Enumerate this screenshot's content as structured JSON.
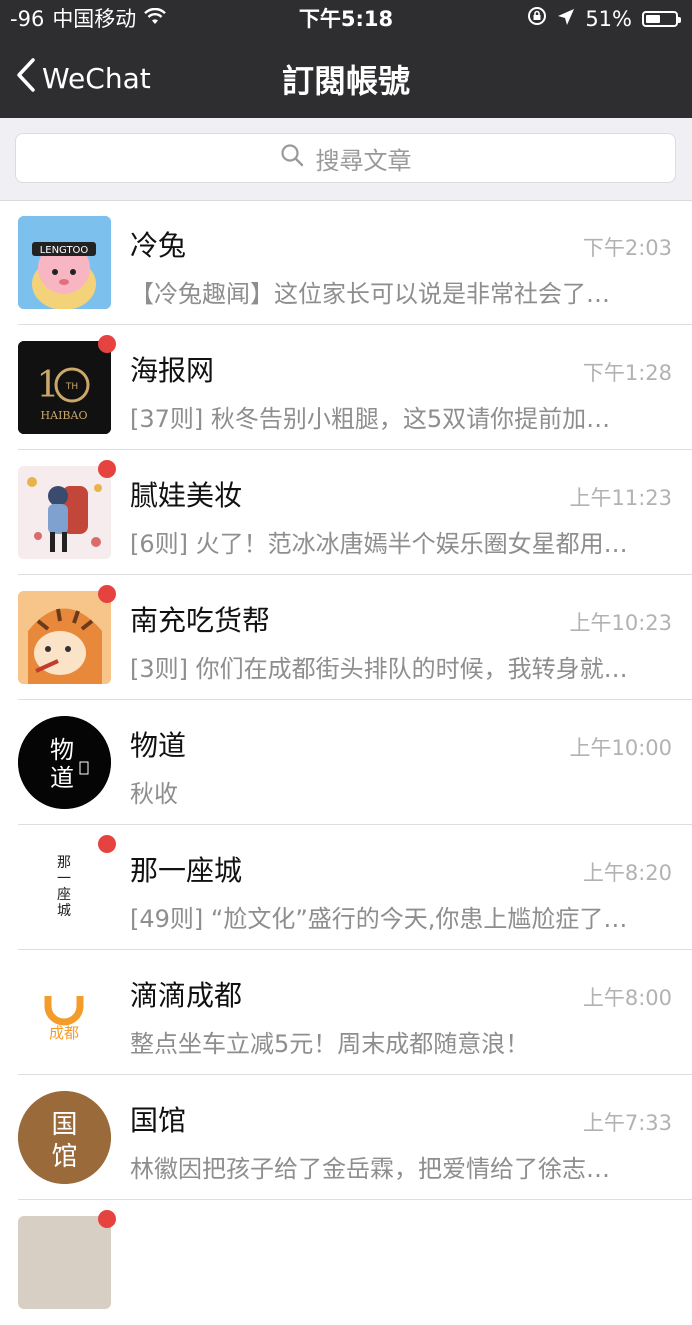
{
  "status_bar": {
    "signal": "-96",
    "carrier": "中国移动",
    "time": "下午5:18",
    "battery": "51%",
    "battery_level": 0.51
  },
  "nav": {
    "back_label": "WeChat",
    "title": "訂閱帳號"
  },
  "search": {
    "placeholder": "搜尋文章"
  },
  "items": [
    {
      "name": "冷兔",
      "time": "下午2:03",
      "preview": "【冷兔趣闻】这位家长可以说是非常社会了…",
      "unread": false,
      "avatar_text": "LENGTOO",
      "avatar_color": "#6fb5e8"
    },
    {
      "name": "海报网",
      "time": "下午1:28",
      "preview": "[37则] 秋冬告别小粗腿，这5双请你提前加…",
      "unread": true,
      "avatar_text": "HAIBAO",
      "avatar_color": "#111111"
    },
    {
      "name": "腻娃美妆",
      "time": "上午11:23",
      "preview": "[6则] 火了！范冰冰唐嫣半个娱乐圈女星都用…",
      "unread": true,
      "avatar_text": "",
      "avatar_color": "#f3e6ea"
    },
    {
      "name": "南充吃货帮",
      "time": "上午10:23",
      "preview": "[3则] 你们在成都街头排队的时候，我转身就…",
      "unread": true,
      "avatar_text": "",
      "avatar_color": "#f5a14b"
    },
    {
      "name": "物道",
      "time": "上午10:00",
      "preview": "秋收",
      "unread": false,
      "avatar_text": "物道",
      "avatar_color": "#000000"
    },
    {
      "name": "那一座城",
      "time": "上午8:20",
      "preview": "[49则] “尬文化”盛行的今天,你患上尴尬症了…",
      "unread": true,
      "avatar_text": "那一座城",
      "avatar_color": "#ffffff"
    },
    {
      "name": "滴滴成都",
      "time": "上午8:00",
      "preview": "整点坐车立减5元！周末成都随意浪！",
      "unread": false,
      "avatar_text": "成都",
      "avatar_color": "#ffffff"
    },
    {
      "name": "国馆",
      "time": "上午7:33",
      "preview": "林徽因把孩子给了金岳霖，把爱情给了徐志…",
      "unread": false,
      "avatar_text": "国馆",
      "avatar_color": "#9b6a3a"
    }
  ],
  "colors": {
    "nav_bg": "#2e2e31",
    "unread_dot": "#e64340",
    "search_bg": "#efeff4"
  }
}
